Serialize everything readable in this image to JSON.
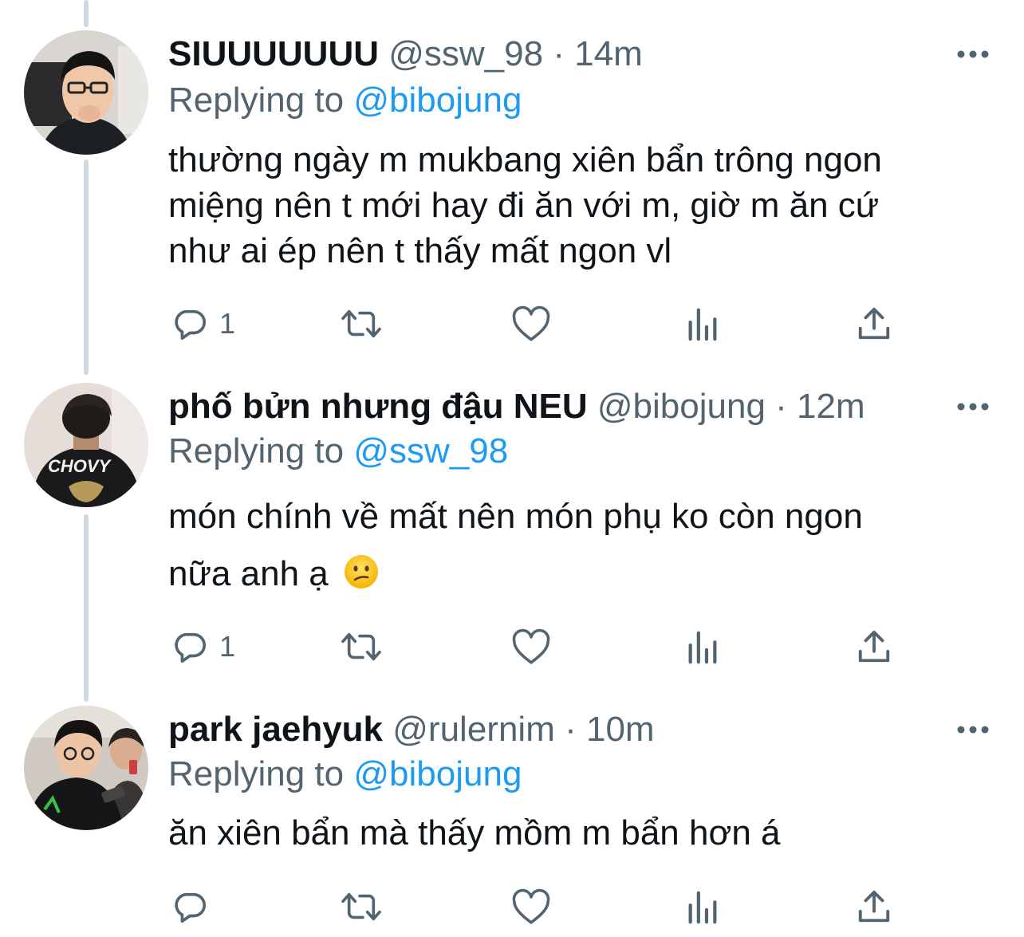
{
  "tweets": [
    {
      "display_name": "SIUUUUUUU",
      "handle": "@ssw_98",
      "separator": "·",
      "time": "14m",
      "replying_label": "Replying to",
      "replying_to": "@bibojung",
      "lines": [
        "thường ngày m mukbang xiên bẩn trông ngon",
        "miệng nên t mới hay đi ăn với m, giờ m ăn cứ",
        "như ai ép nên t thấy mất ngon vl"
      ],
      "reply_count": "1",
      "retweet_count": "",
      "like_count": ""
    },
    {
      "display_name": "phố bửn nhưng đậu NEU",
      "handle": "@bibojung",
      "separator": "·",
      "time": "12m",
      "replying_label": "Replying to",
      "replying_to": "@ssw_98",
      "lines": [
        "món chính về mất nên món phụ ko còn ngon",
        "nữa anh ạ"
      ],
      "emoji": "confused-face-emoji",
      "reply_count": "1",
      "retweet_count": "",
      "like_count": ""
    },
    {
      "display_name": "park jaehyuk",
      "handle": "@rulernim",
      "separator": "·",
      "time": "10m",
      "replying_label": "Replying to",
      "replying_to": "@bibojung",
      "lines": [
        "ăn xiên bẩn mà thấy mồm m bẩn hơn á"
      ],
      "reply_count": "",
      "retweet_count": "",
      "like_count": ""
    }
  ],
  "icons": {
    "reply": "reply-icon",
    "retweet": "retweet-icon",
    "like": "heart-icon",
    "analytics": "analytics-icon",
    "share": "share-icon",
    "more": "more-options-icon"
  },
  "colors": {
    "accent": "#1d9bf0",
    "secondary_text": "#536471",
    "primary_text": "#0f1419",
    "thread_line": "#cfd9de"
  }
}
